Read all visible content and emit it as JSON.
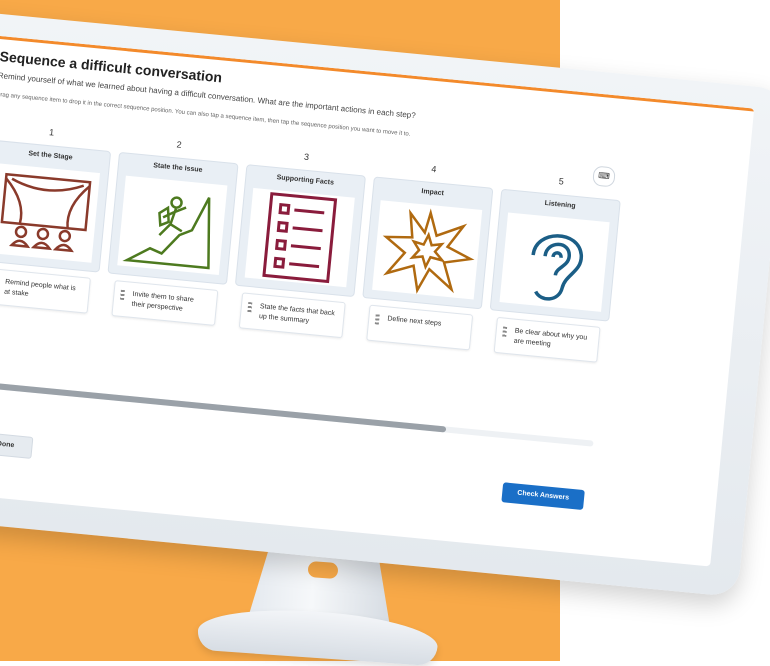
{
  "activity": {
    "title": "Sequence a difficult conversation",
    "subtitle": "Remind yourself of what we learned about having a difficult conversation. What are the important actions in each step?",
    "instructions": "Drag any sequence item to drop it in the correct sequence position. You can also tap a sequence item, then tap the sequence position you want to move it to."
  },
  "controls": {
    "keyboard_icon": "keyboard-icon",
    "next_icon": "chevron-right-icon",
    "next_glyph": "›",
    "keyboard_glyph": "⌨"
  },
  "steps": [
    {
      "number": "1",
      "title": "Set the Stage",
      "icon": "stage-audience-icon",
      "item": "Remind people what is at stake"
    },
    {
      "number": "2",
      "title": "State the Issue",
      "icon": "climber-icon",
      "item": "Invite them to share their perspective"
    },
    {
      "number": "3",
      "title": "Supporting Facts",
      "icon": "checklist-icon",
      "item": "State the facts that back up the summary"
    },
    {
      "number": "4",
      "title": "Impact",
      "icon": "explosion-icon",
      "item": "Define next steps"
    },
    {
      "number": "5",
      "title": "Listening",
      "icon": "ear-icon",
      "item": "Be clear about why you are meeting"
    }
  ],
  "scrollbar": {
    "position": 0.76
  },
  "buttons": {
    "done": "Done",
    "check": "Check Answers"
  },
  "colors": {
    "background": "#f8a948",
    "accent": "#f38a2b",
    "primary_button": "#1a6fc7",
    "stage_icon": "#8a3a2b",
    "climber_icon": "#4d7a1f",
    "checklist_icon": "#8a1c3c",
    "explosion_icon": "#b06a10",
    "ear_icon": "#1b5e86"
  }
}
